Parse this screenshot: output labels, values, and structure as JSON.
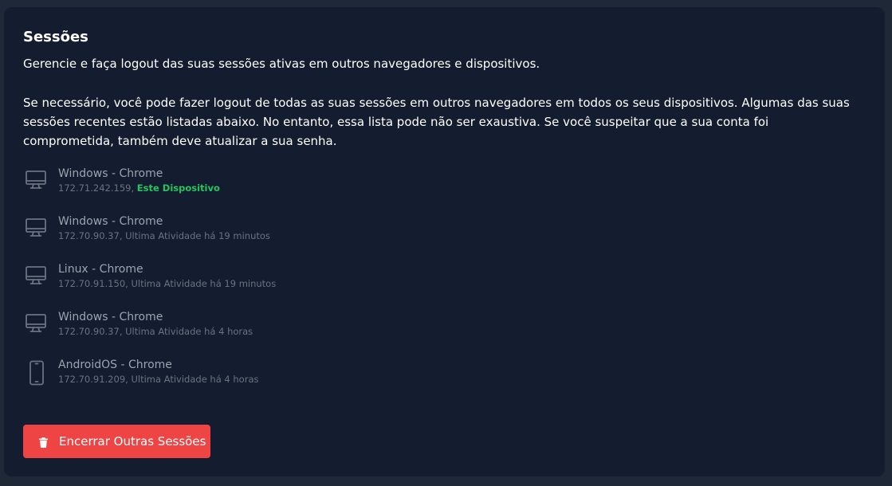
{
  "section": {
    "title": "Sessões",
    "subtitle": "Gerencie e faça logout das suas sessões ativas em outros navegadores e dispositivos.",
    "description": "Se necessário, você pode fazer logout de todas as suas sessões em outros navegadores em todos os seus dispositivos. Algumas das suas sessões recentes estão listadas abaixo. No entanto, essa lista pode não ser exaustiva. Se você suspeitar que a sua conta foi comprometida, também deve atualizar a sua senha."
  },
  "sessions": [
    {
      "icon": "desktop-icon",
      "device": "Windows - Chrome",
      "ip": "172.71.242.159,",
      "status": "Este Dispositivo",
      "current": true
    },
    {
      "icon": "desktop-icon",
      "device": "Windows - Chrome",
      "ip": "172.70.90.37,",
      "status": "Ultima Atividade há 19 minutos",
      "current": false
    },
    {
      "icon": "desktop-icon",
      "device": "Linux - Chrome",
      "ip": "172.70.91.150,",
      "status": "Ultima Atividade há 19 minutos",
      "current": false
    },
    {
      "icon": "desktop-icon",
      "device": "Windows - Chrome",
      "ip": "172.70.90.37,",
      "status": "Ultima Atividade há 4 horas",
      "current": false
    },
    {
      "icon": "mobile-icon",
      "device": "AndroidOS - Chrome",
      "ip": "172.70.91.209,",
      "status": "Ultima Atividade há 4 horas",
      "current": false
    }
  ],
  "actions": {
    "logout_label": "Encerrar Outras Sessões",
    "logout_icon": "trash-icon"
  },
  "colors": {
    "background": "#1e2837",
    "card": "#141d2f",
    "accent_danger": "#ef4444",
    "current_device": "#22c55e",
    "muted_text": "#9ca3af"
  }
}
